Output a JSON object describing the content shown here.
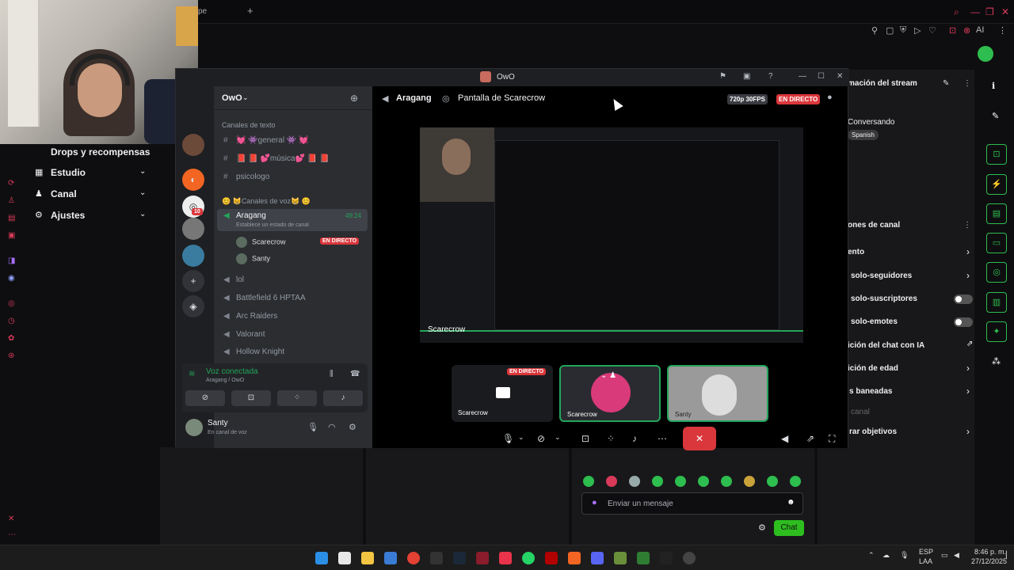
{
  "webcam": {
    "label": "webcam"
  },
  "browser": {
    "tab_partial": "pe",
    "new_tab": "+",
    "ai_label": "AI"
  },
  "left_nav": {
    "items": [
      {
        "label": "Drops y recompensas"
      },
      {
        "label": "Estudio"
      },
      {
        "label": "Canal"
      },
      {
        "label": "Ajustes"
      }
    ]
  },
  "right_panel": {
    "stream_info_title": "mación del stream",
    "category": "Conversando",
    "tag": "Spanish",
    "channel_options_title": "ones de canal",
    "rows": [
      {
        "label": "ento",
        "kind": "chevron"
      },
      {
        "label": "solo-seguidores",
        "kind": "chevron"
      },
      {
        "label": "solo-suscriptores",
        "kind": "toggle"
      },
      {
        "label": "solo-emotes",
        "kind": "toggle"
      },
      {
        "label": "ición del chat con IA",
        "kind": "link"
      },
      {
        "label": "ición de edad",
        "kind": "chevron"
      },
      {
        "label": "s baneadas",
        "kind": "chevron"
      },
      {
        "label": "canal",
        "kind": "muted"
      },
      {
        "label": "rar objetivos",
        "kind": "chevron"
      }
    ]
  },
  "chat": {
    "placeholder": "Enviar un mensaje",
    "send_label": "Chat"
  },
  "discord": {
    "window_title": "OwO",
    "server_name": "OwO",
    "text_category": "Canales de texto",
    "text_channels": [
      {
        "label": "💓 👾general 👾 💓"
      },
      {
        "label": "📕 📕 💕música💕 📕 📕"
      },
      {
        "label": "psicologo"
      }
    ],
    "voice_category": "😊 😸Canales de voz😸 😊",
    "active_voice": {
      "label": "Aragang",
      "time": "49:24",
      "status": "Establece un estado de canal"
    },
    "voice_users": [
      {
        "name": "Scarecrow",
        "live": "EN DIRECTO"
      },
      {
        "name": "Santy",
        "live": ""
      }
    ],
    "voice_channels": [
      {
        "label": "lol"
      },
      {
        "label": "Battlefield 6 HPTAA"
      },
      {
        "label": "Arc Raiders"
      },
      {
        "label": "Valorant"
      },
      {
        "label": "Hollow Knight"
      }
    ],
    "voice_connected": {
      "title": "Voz conectada",
      "sub": "Aragang / OwO"
    },
    "user": {
      "name": "Santy",
      "status": "En canal de voz"
    },
    "stage": {
      "channel": "Aragang",
      "screen": "Pantalla de Scarecrow",
      "quality": "720p 30FPS",
      "live": "EN DIRECTO",
      "main_label": "Scarecrow",
      "tiles": [
        {
          "label": "Scarecrow",
          "live": "EN DIRECTO"
        },
        {
          "label": "Scarecrow",
          "live": ""
        },
        {
          "label": "Santy",
          "live": ""
        }
      ]
    },
    "server_badge": "10"
  },
  "taskbar": {
    "lang": "ESP",
    "region": "LAA",
    "time": "8:46 p. m.",
    "date": "27/12/2025"
  },
  "colors": {
    "accent_green": "#2ebd4f",
    "live_red": "#da373c",
    "twitch_red": "#d93a5a"
  }
}
